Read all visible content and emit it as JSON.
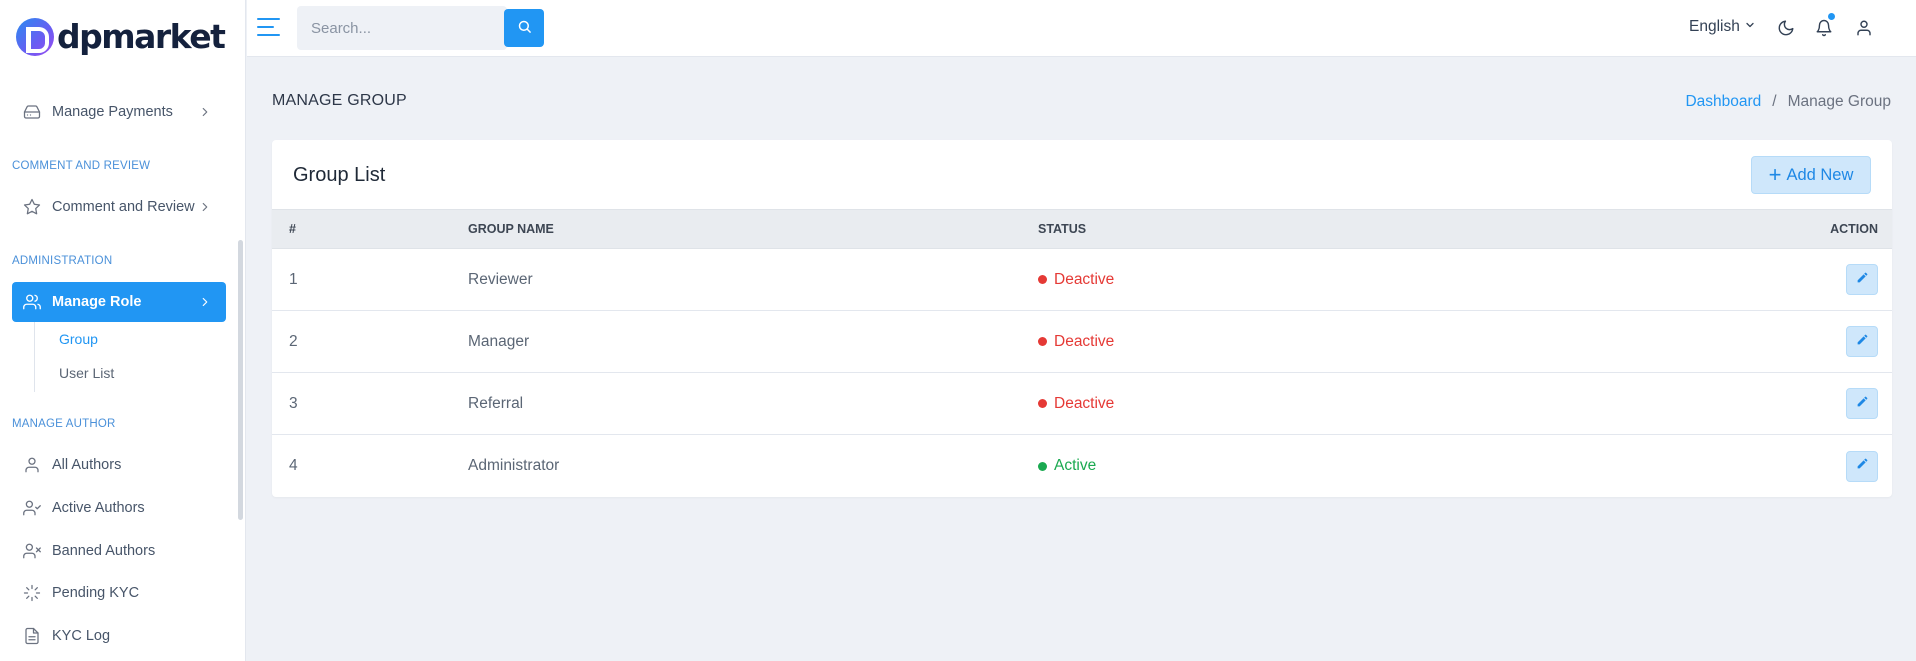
{
  "brand": {
    "name": "dpmarket"
  },
  "sidebar": {
    "items": [
      {
        "label": "Manage Payments",
        "icon": "payment-icon"
      },
      {
        "label": "Comment and Review",
        "icon": "star-icon"
      },
      {
        "label": "Manage Role",
        "icon": "users-icon",
        "active": true
      },
      {
        "label": "All Authors",
        "icon": "user-icon"
      },
      {
        "label": "Active Authors",
        "icon": "user-check-icon"
      },
      {
        "label": "Banned Authors",
        "icon": "user-x-icon"
      },
      {
        "label": "Pending KYC",
        "icon": "loader-icon"
      },
      {
        "label": "KYC Log",
        "icon": "file-icon"
      }
    ],
    "sections": [
      "COMMENT AND REVIEW",
      "ADMINISTRATION",
      "MANAGE AUTHOR"
    ],
    "submenu": [
      {
        "label": "Group",
        "current": true
      },
      {
        "label": "User List"
      }
    ]
  },
  "topbar": {
    "search_placeholder": "Search...",
    "language": "English"
  },
  "page": {
    "title": "MANAGE GROUP",
    "breadcrumb": {
      "home": "Dashboard",
      "separator": "/",
      "current": "Manage Group"
    }
  },
  "card": {
    "title": "Group List",
    "add_button": "Add New"
  },
  "table": {
    "headers": [
      "#",
      "GROUP NAME",
      "STATUS",
      "ACTION"
    ],
    "rows": [
      {
        "num": "1",
        "name": "Reviewer",
        "status": "Deactive"
      },
      {
        "num": "2",
        "name": "Manager",
        "status": "Deactive"
      },
      {
        "num": "3",
        "name": "Referral",
        "status": "Deactive"
      },
      {
        "num": "4",
        "name": "Administrator",
        "status": "Active"
      }
    ]
  },
  "colors": {
    "primary": "#2196f3",
    "deactive": "#e53935",
    "active": "#1aa950",
    "background": "#eef1f6"
  }
}
